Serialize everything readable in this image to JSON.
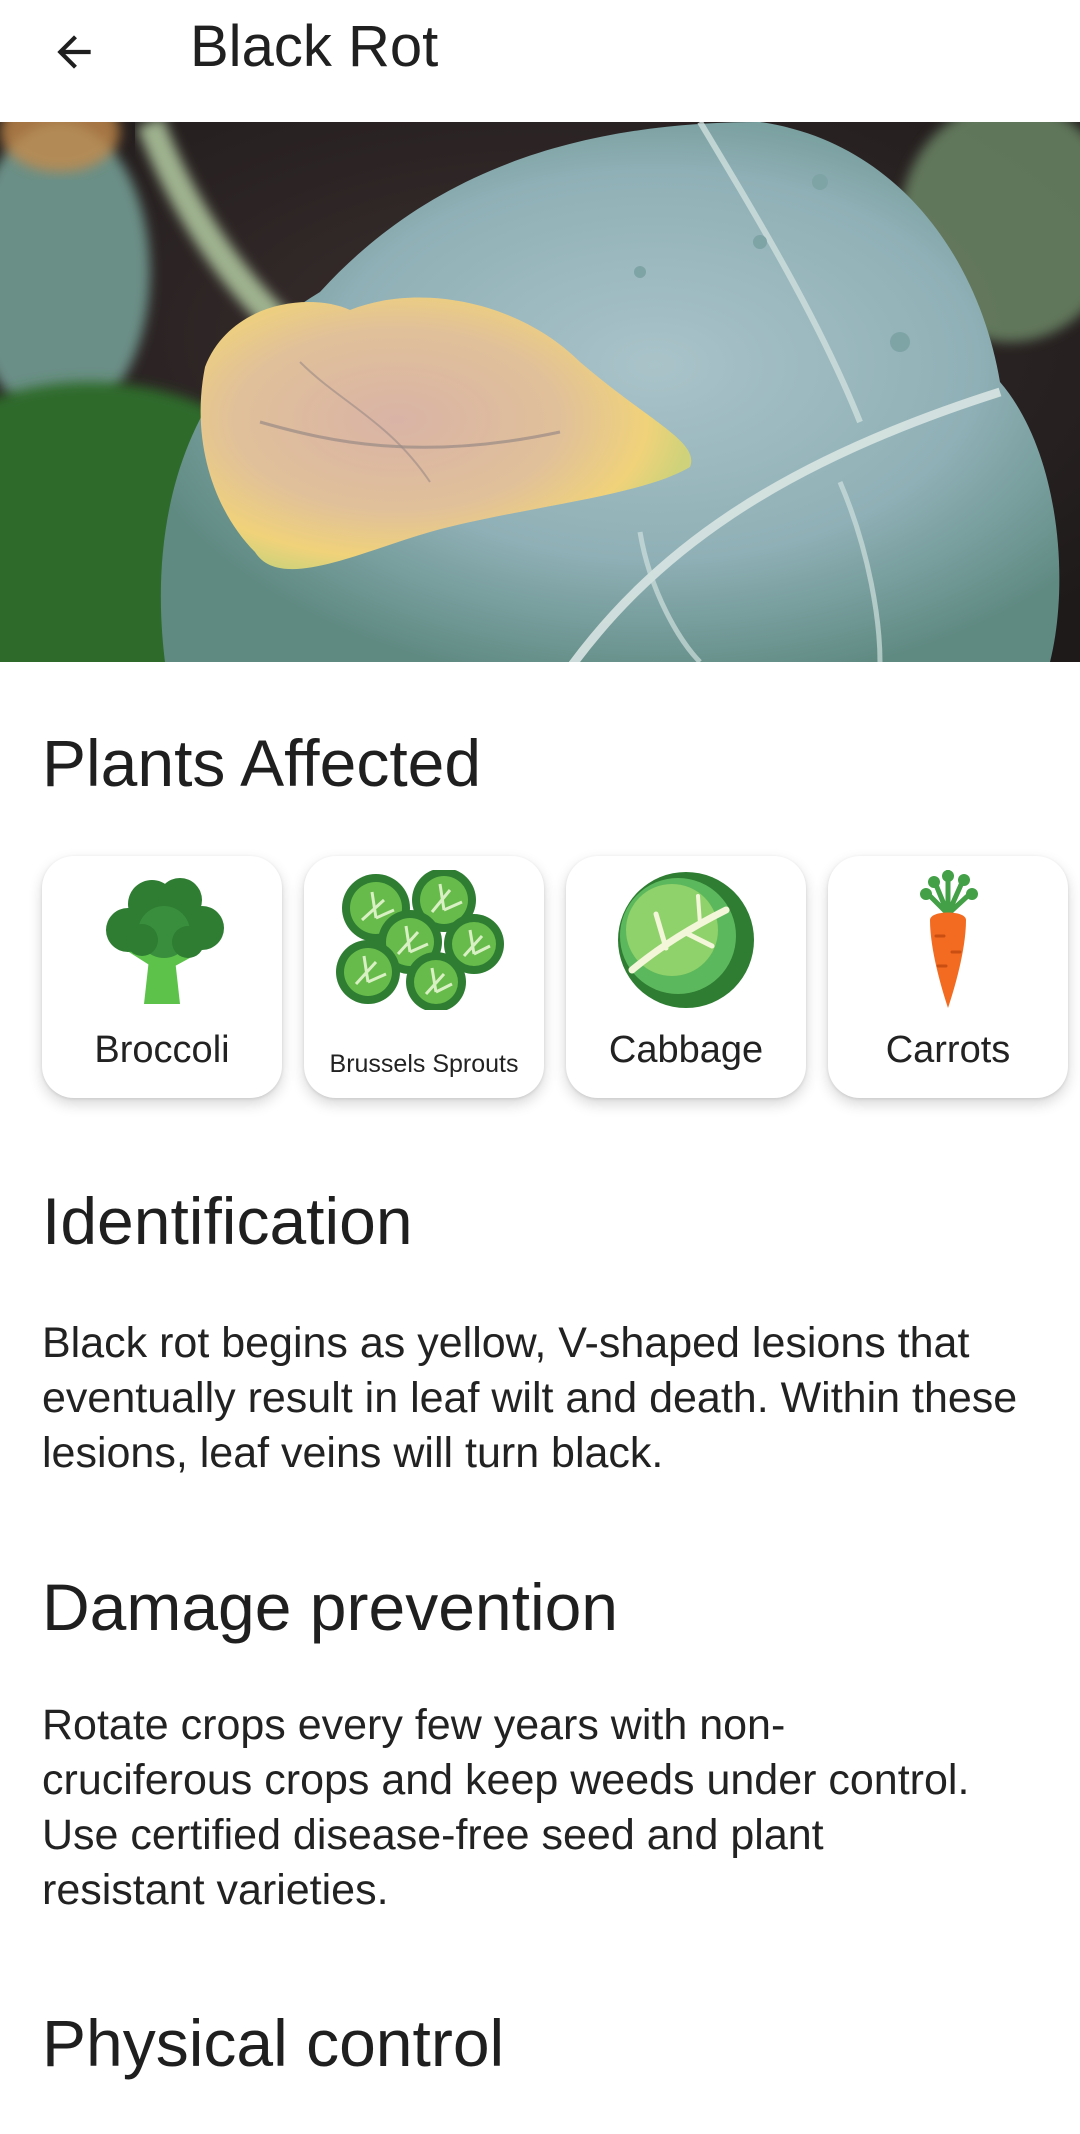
{
  "appbar": {
    "title": "Black Rot"
  },
  "icons": {
    "back": "arrow-left-icon"
  },
  "hero": {
    "alt": "leaf with black rot lesion"
  },
  "plants_section": {
    "title": "Plants Affected",
    "plants": [
      {
        "name": "Broccoli",
        "icon": "broccoli-icon"
      },
      {
        "name": "Brussels Sprouts",
        "icon": "brussels-sprouts-icon"
      },
      {
        "name": "Cabbage",
        "icon": "cabbage-icon"
      },
      {
        "name": "Carrots",
        "icon": "carrot-icon"
      }
    ]
  },
  "identification": {
    "title": "Identification",
    "text": "Black rot begins as yellow, V-shaped lesions that eventually result in leaf wilt and death. Within these lesions, leaf veins will turn black."
  },
  "damage_prevention": {
    "title": "Damage prevention",
    "text": "Rotate crops every few years with non-cruciferous crops and keep weeds under control. Use certified disease-free seed and plant resistant varieties."
  },
  "physical_control": {
    "title": "Physical control"
  }
}
